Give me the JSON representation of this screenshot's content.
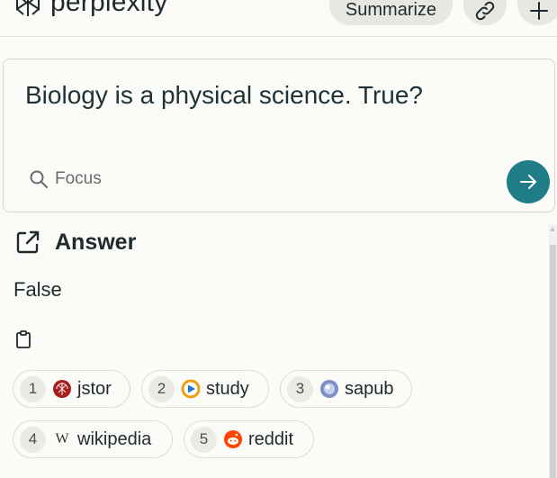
{
  "header": {
    "logo_text": "perplexity",
    "summarize_label": "Summarize",
    "link_icon": "link-icon",
    "plus_icon": "plus-icon"
  },
  "query": {
    "text": "Biology is a physical science. True?",
    "focus_label": "Focus",
    "submit_icon": "arrow-right-icon"
  },
  "answer": {
    "title": "Answer",
    "text": "False"
  },
  "sources": [
    {
      "num": "1",
      "label": "jstor",
      "icon": "jstor-icon"
    },
    {
      "num": "2",
      "label": "study",
      "icon": "study-icon"
    },
    {
      "num": "3",
      "label": "sapub",
      "icon": "sapub-icon"
    },
    {
      "num": "4",
      "label": "wikipedia",
      "icon": "wikipedia-icon",
      "icon_text": "W"
    },
    {
      "num": "5",
      "label": "reddit",
      "icon": "reddit-icon"
    }
  ],
  "colors": {
    "accent": "#1f7d88",
    "background": "#fbfbf8"
  }
}
